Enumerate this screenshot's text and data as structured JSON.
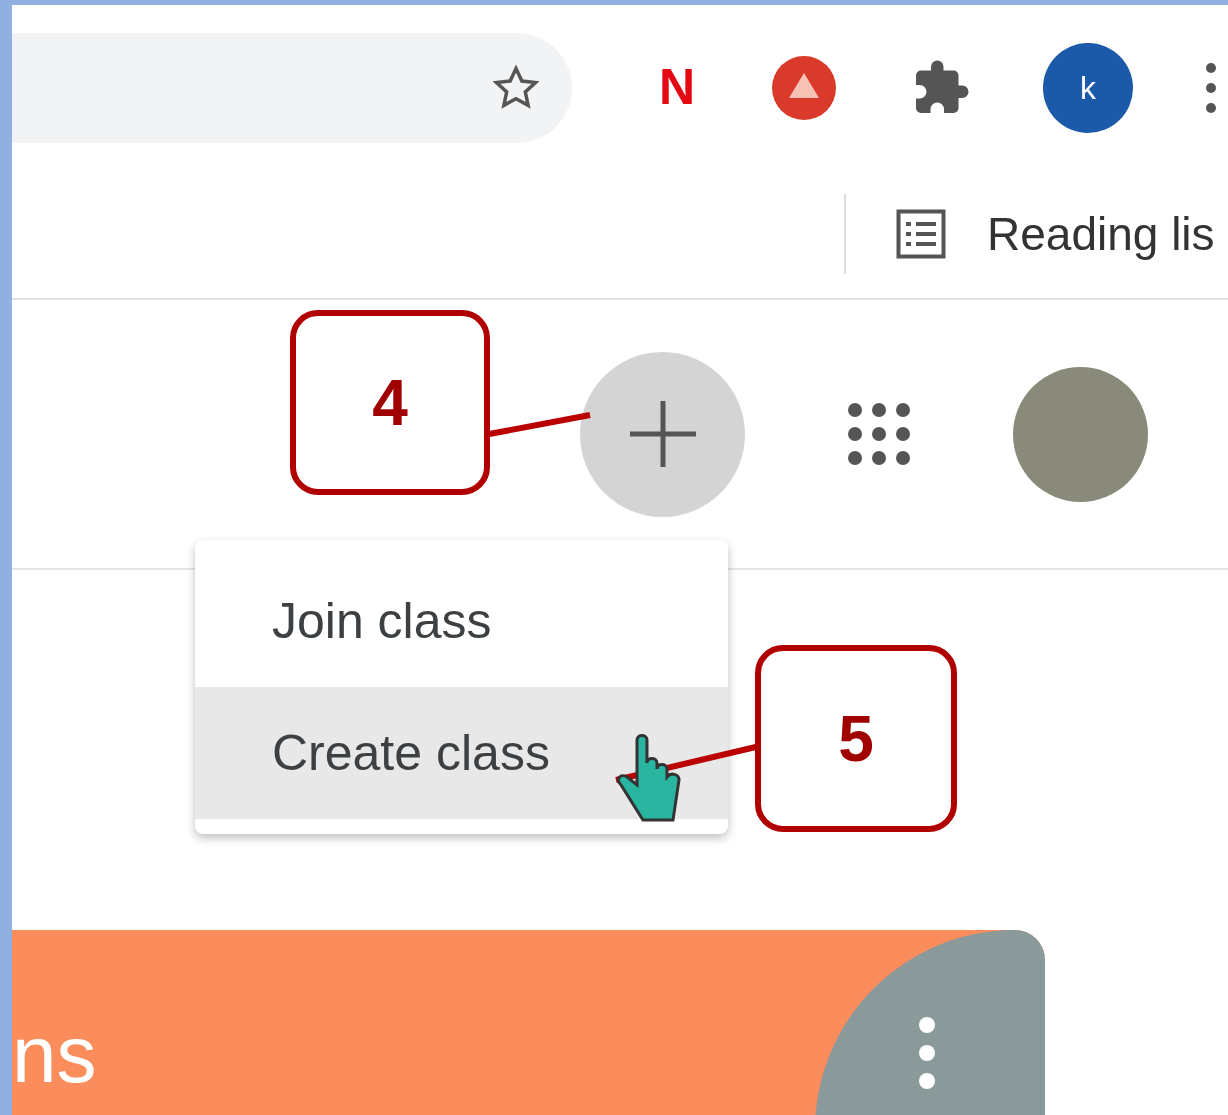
{
  "browser": {
    "profile_letter": "k",
    "extension_letter": "N",
    "bookmarks": [
      {
        "label": "Reading lis"
      }
    ]
  },
  "menu": {
    "items": [
      {
        "label": "Join class",
        "selected": false
      },
      {
        "label": "Create class",
        "selected": true
      }
    ]
  },
  "callouts": [
    {
      "label": "4"
    },
    {
      "label": "5"
    }
  ],
  "class_card": {
    "title": "ns"
  }
}
